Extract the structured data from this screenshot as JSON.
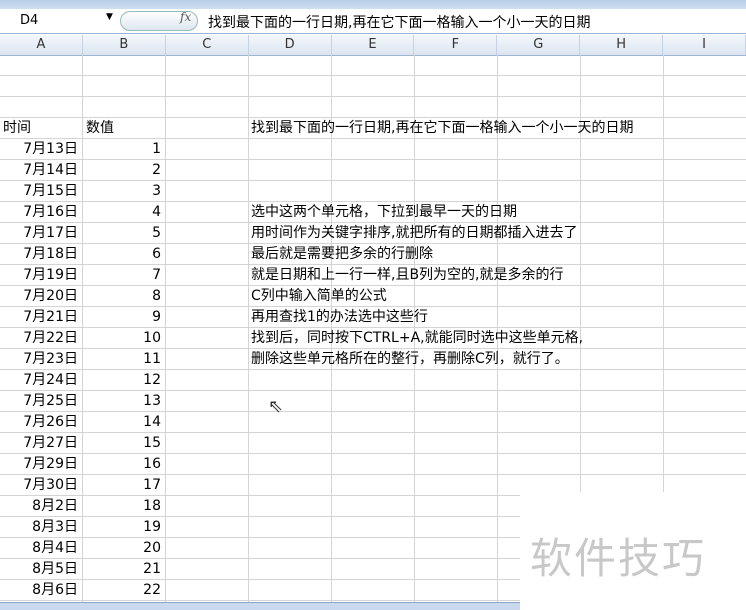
{
  "formula_bar": {
    "name_box": "D4",
    "fx": "fx",
    "formula": "找到最下面的一行日期,再在它下面一格输入一个小一天的日期"
  },
  "columns": [
    "A",
    "B",
    "C",
    "D",
    "E",
    "F",
    "G",
    "H",
    "I"
  ],
  "headers": {
    "a": "时间",
    "b": "数值"
  },
  "rows": [
    {
      "date": "7月13日",
      "value": "1"
    },
    {
      "date": "7月14日",
      "value": "2"
    },
    {
      "date": "7月15日",
      "value": "3"
    },
    {
      "date": "7月16日",
      "value": "4"
    },
    {
      "date": "7月17日",
      "value": "5"
    },
    {
      "date": "7月18日",
      "value": "6"
    },
    {
      "date": "7月19日",
      "value": "7"
    },
    {
      "date": "7月20日",
      "value": "8"
    },
    {
      "date": "7月21日",
      "value": "9"
    },
    {
      "date": "7月22日",
      "value": "10"
    },
    {
      "date": "7月23日",
      "value": "11"
    },
    {
      "date": "7月24日",
      "value": "12"
    },
    {
      "date": "7月25日",
      "value": "13"
    },
    {
      "date": "7月26日",
      "value": "14"
    },
    {
      "date": "7月27日",
      "value": "15"
    },
    {
      "date": "7月29日",
      "value": "16"
    },
    {
      "date": "7月30日",
      "value": "17"
    },
    {
      "date": "8月2日",
      "value": "18"
    },
    {
      "date": "8月3日",
      "value": "19"
    },
    {
      "date": "8月4日",
      "value": "20"
    },
    {
      "date": "8月5日",
      "value": "21"
    },
    {
      "date": "8月6日",
      "value": "22"
    }
  ],
  "notes": {
    "d4": "找到最下面的一行日期,再在它下面一格输入一个小一天的日期",
    "steps": [
      "选中这两个单元格，下拉到最早一天的日期",
      "用时间作为关键字排序,就把所有的日期都插入进去了",
      "最后就是需要把多余的行删除",
      "就是日期和上一行一样,且B列为空的,就是多余的行",
      "C列中输入简单的公式",
      "再用查找1的办法选中这些行",
      "找到后，同时按下CTRL+A,就能同时选中这些单元格,",
      "删除这些单元格所在的整行，再删除C列，就行了。"
    ]
  },
  "watermark": "软件技巧"
}
